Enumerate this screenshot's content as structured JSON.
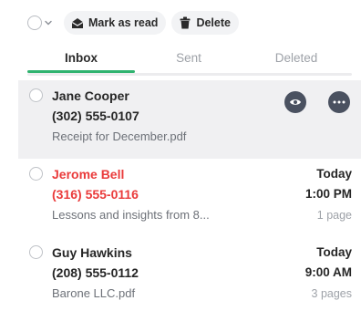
{
  "toolbar": {
    "select_all_icon": "checkbox-circle",
    "dropdown_icon": "chevron-down-icon",
    "mark_read": {
      "icon": "envelope-open-icon",
      "label": "Mark as read"
    },
    "delete": {
      "icon": "trash-icon",
      "label": "Delete"
    }
  },
  "tabs": [
    {
      "label": "Inbox",
      "active": true
    },
    {
      "label": "Sent",
      "active": false
    },
    {
      "label": "Deleted",
      "active": false
    }
  ],
  "colors": {
    "accent": "#2fb36f",
    "missed": "#ea3b3b",
    "selected_row": "#f0f0f2",
    "action_button": "#4a5160"
  },
  "messages": [
    {
      "name": "Jane Cooper",
      "phone": "(302) 555-0107",
      "description": "Receipt for December.pdf",
      "selected": true,
      "actions": [
        {
          "icon": "eye-icon"
        },
        {
          "icon": "more-icon"
        }
      ]
    },
    {
      "name": "Jerome Bell",
      "phone": "(316) 555-0116",
      "description": "Lessons and insights from 8...",
      "day": "Today",
      "time": "1:00 PM",
      "pages": "1 page",
      "missed": true
    },
    {
      "name": "Guy Hawkins",
      "phone": "(208) 555-0112",
      "description": "Barone LLC.pdf",
      "day": "Today",
      "time": "9:00 AM",
      "pages": "3 pages"
    }
  ]
}
